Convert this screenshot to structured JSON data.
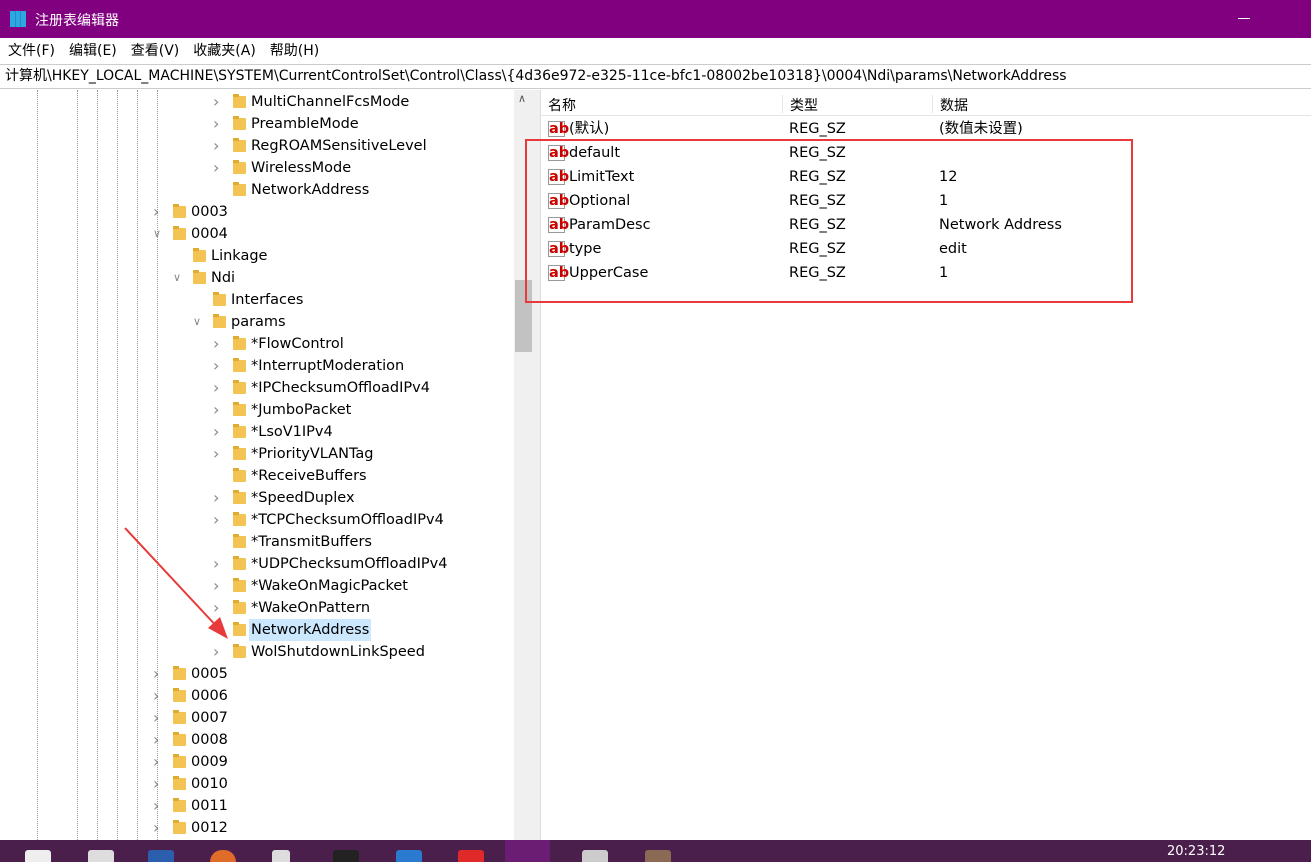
{
  "window": {
    "title": "注册表编辑器"
  },
  "menu": [
    "文件(F)",
    "编辑(E)",
    "查看(V)",
    "收藏夹(A)",
    "帮助(H)"
  ],
  "address": "计算机\\HKEY_LOCAL_MACHINE\\SYSTEM\\CurrentControlSet\\Control\\Class\\{4d36e972-e325-11ce-bfc1-08002be10318}\\0004\\Ndi\\params\\NetworkAddress",
  "tree": [
    {
      "label": "MultiChannelFcsMode",
      "level": 6,
      "expander": "collapsed"
    },
    {
      "label": "PreambleMode",
      "level": 6,
      "expander": "collapsed"
    },
    {
      "label": "RegROAMSensitiveLevel",
      "level": 6,
      "expander": "collapsed"
    },
    {
      "label": "WirelessMode",
      "level": 6,
      "expander": "collapsed"
    },
    {
      "label": "NetworkAddress",
      "level": 6,
      "expander": "none"
    },
    {
      "label": "0003",
      "level": 3,
      "expander": "collapsed"
    },
    {
      "label": "0004",
      "level": 3,
      "expander": "expanded"
    },
    {
      "label": "Linkage",
      "level": 4,
      "expander": "none"
    },
    {
      "label": "Ndi",
      "level": 4,
      "expander": "expanded"
    },
    {
      "label": "Interfaces",
      "level": 5,
      "expander": "none"
    },
    {
      "label": "params",
      "level": 5,
      "expander": "expanded"
    },
    {
      "label": "*FlowControl",
      "level": 6,
      "expander": "collapsed"
    },
    {
      "label": "*InterruptModeration",
      "level": 6,
      "expander": "collapsed"
    },
    {
      "label": "*IPChecksumOffloadIPv4",
      "level": 6,
      "expander": "collapsed"
    },
    {
      "label": "*JumboPacket",
      "level": 6,
      "expander": "collapsed"
    },
    {
      "label": "*LsoV1IPv4",
      "level": 6,
      "expander": "collapsed"
    },
    {
      "label": "*PriorityVLANTag",
      "level": 6,
      "expander": "collapsed"
    },
    {
      "label": "*ReceiveBuffers",
      "level": 6,
      "expander": "none"
    },
    {
      "label": "*SpeedDuplex",
      "level": 6,
      "expander": "collapsed"
    },
    {
      "label": "*TCPChecksumOffloadIPv4",
      "level": 6,
      "expander": "collapsed"
    },
    {
      "label": "*TransmitBuffers",
      "level": 6,
      "expander": "none"
    },
    {
      "label": "*UDPChecksumOffloadIPv4",
      "level": 6,
      "expander": "collapsed"
    },
    {
      "label": "*WakeOnMagicPacket",
      "level": 6,
      "expander": "collapsed"
    },
    {
      "label": "*WakeOnPattern",
      "level": 6,
      "expander": "collapsed"
    },
    {
      "label": "NetworkAddress",
      "level": 6,
      "expander": "none",
      "selected": true
    },
    {
      "label": "WolShutdownLinkSpeed",
      "level": 6,
      "expander": "collapsed"
    },
    {
      "label": "0005",
      "level": 3,
      "expander": "collapsed"
    },
    {
      "label": "0006",
      "level": 3,
      "expander": "collapsed"
    },
    {
      "label": "0007",
      "level": 3,
      "expander": "collapsed"
    },
    {
      "label": "0008",
      "level": 3,
      "expander": "collapsed"
    },
    {
      "label": "0009",
      "level": 3,
      "expander": "collapsed"
    },
    {
      "label": "0010",
      "level": 3,
      "expander": "collapsed"
    },
    {
      "label": "0011",
      "level": 3,
      "expander": "collapsed"
    },
    {
      "label": "0012",
      "level": 3,
      "expander": "collapsed"
    }
  ],
  "list": {
    "columns": [
      "名称",
      "类型",
      "数据"
    ],
    "rows": [
      {
        "name": "(默认)",
        "type": "REG_SZ",
        "data": "(数值未设置)"
      },
      {
        "name": "default",
        "type": "REG_SZ",
        "data": ""
      },
      {
        "name": "LimitText",
        "type": "REG_SZ",
        "data": "12"
      },
      {
        "name": "Optional",
        "type": "REG_SZ",
        "data": "1"
      },
      {
        "name": "ParamDesc",
        "type": "REG_SZ",
        "data": "Network Address"
      },
      {
        "name": "type",
        "type": "REG_SZ",
        "data": "edit"
      },
      {
        "name": "UpperCase",
        "type": "REG_SZ",
        "data": "1"
      }
    ]
  },
  "taskbar": {
    "clock": "20:23:12"
  },
  "colors": {
    "titlebar": "#800080",
    "highlight_box": "#e83a3a",
    "selection": "#cce8ff"
  }
}
